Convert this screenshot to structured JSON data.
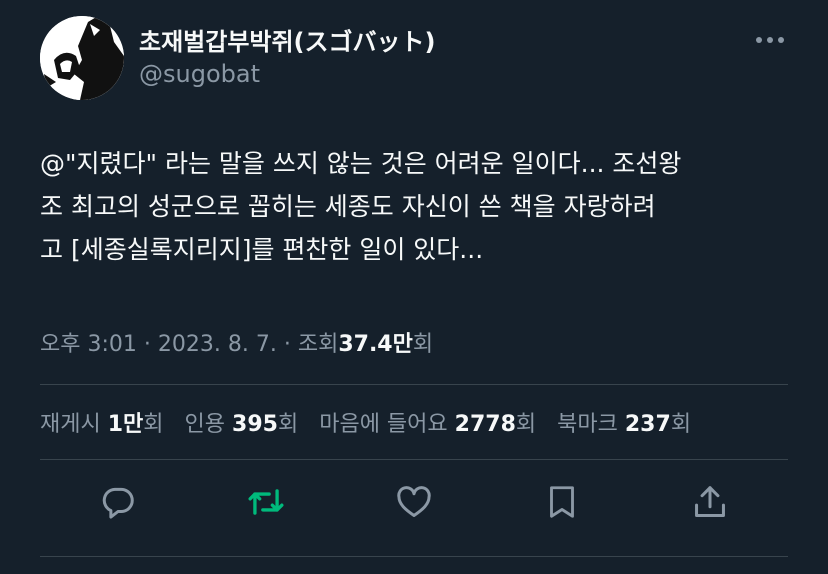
{
  "author": {
    "display_name": "초재벌갑부박쥐(スゴバット)",
    "handle": "@sugobat"
  },
  "tweet": {
    "lines": [
      "@\"지렸다\" 라는 말을 쓰지 않는 것은 어려운 일이다... 조선왕",
      "조 최고의 성군으로 꼽히는 세종도 자신이 쓴 책을 자랑하려",
      "고 [세종실록지리지]를 편찬한 일이 있다..."
    ]
  },
  "meta": {
    "time": "오후 3:01",
    "date": "2023. 8. 7.",
    "views_label_prefix": "조회",
    "views_value": "37.4만",
    "views_label_suffix": "회",
    "separator": "·"
  },
  "stats": {
    "retweets": {
      "label": "재게시",
      "value": "1만",
      "suffix": "회"
    },
    "quotes": {
      "label": "인용",
      "value": "395",
      "suffix": "회"
    },
    "likes": {
      "label": "마음에 들어요",
      "value": "2778",
      "suffix": "회"
    },
    "bookmarks": {
      "label": "북마크",
      "value": "237",
      "suffix": "회"
    }
  },
  "icons": {
    "reply": "reply-icon",
    "retweet": "retweet-icon",
    "like": "heart-icon",
    "bookmark": "bookmark-icon",
    "share": "share-icon",
    "more": "more-icon"
  },
  "colors": {
    "background": "#15202b",
    "text": "#f7f9f9",
    "muted": "#8b98a5",
    "retweet_active": "#00ba7c",
    "divider": "#38444d"
  }
}
